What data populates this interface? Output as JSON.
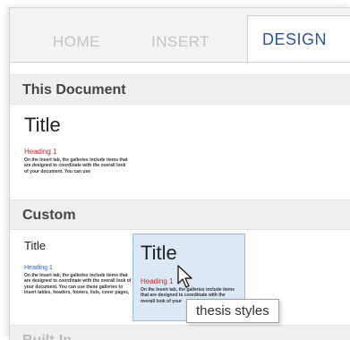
{
  "tabs": [
    {
      "label": "HOME"
    },
    {
      "label": "INSERT"
    },
    {
      "label": "DESIGN",
      "active": true
    }
  ],
  "sections": [
    {
      "header": "This Document",
      "thumbnails": [
        {
          "title": "Title",
          "heading": "Heading 1",
          "body": "On the Insert tab, the galleries include items that are designed to coordinate with the overall look of your document. You can use"
        }
      ]
    },
    {
      "header": "Custom",
      "thumbnails": [
        {
          "title": "Title",
          "heading": "Heading 1",
          "body": "On the Insert tab, the galleries include items that are designed to coordinate with the overall look of your document. You can use these galleries to insert tables, headers, footers, lists, cover pages,"
        },
        {
          "title": "Title",
          "heading": "Heading 1",
          "body": "On the Insert tab, the galleries include items that are designed to coordinate with the overall look of your",
          "hovered": true
        }
      ]
    },
    {
      "header": "Built-In"
    }
  ],
  "tooltip": "thesis styles",
  "colors": {
    "accent": "#2b579a",
    "heading_red": "#d42020",
    "heading_blue": "#2e62b0",
    "hover_bg": "#dce8f6"
  }
}
